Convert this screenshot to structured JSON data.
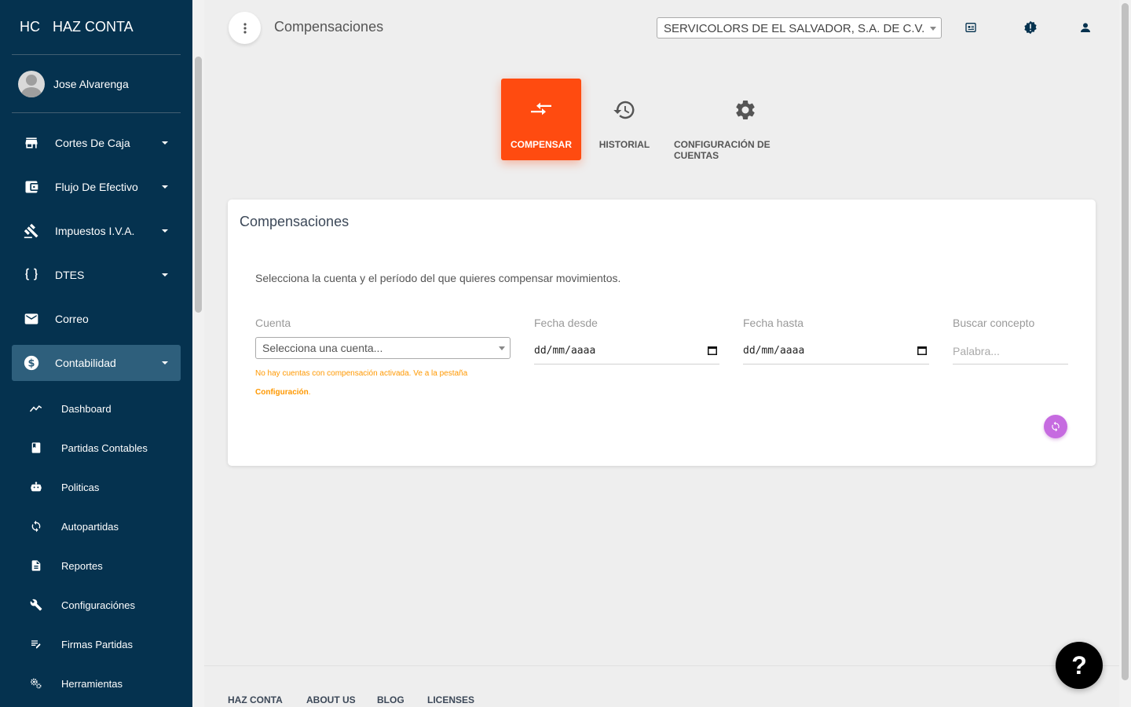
{
  "brand": {
    "mini": "HC",
    "name": "HAZ CONTA"
  },
  "user": {
    "name": "Jose Alvarenga"
  },
  "sidebar": {
    "items": [
      {
        "label": "Cortes De Caja",
        "icon": "store-icon",
        "expandable": true
      },
      {
        "label": "Flujo De Efectivo",
        "icon": "wallet-icon",
        "expandable": true
      },
      {
        "label": "Impuestos I.V.A.",
        "icon": "gavel-icon",
        "expandable": true
      },
      {
        "label": "DTES",
        "icon": "code-braces-icon",
        "expandable": true
      },
      {
        "label": "Correo",
        "icon": "mail-icon",
        "expandable": false
      },
      {
        "label": "Contabilidad",
        "icon": "dollar-icon",
        "expandable": true,
        "active": true
      }
    ],
    "subitems": [
      {
        "label": "Dashboard",
        "icon": "trending-icon"
      },
      {
        "label": "Partidas Contables",
        "icon": "book-icon"
      },
      {
        "label": "Politicas",
        "icon": "robot-icon"
      },
      {
        "label": "Autopartidas",
        "icon": "sync-icon"
      },
      {
        "label": "Reportes",
        "icon": "document-icon"
      },
      {
        "label": "Configuraciónes",
        "icon": "wrench-icon"
      },
      {
        "label": "Firmas Partidas",
        "icon": "edit-list-icon"
      },
      {
        "label": "Herramientas",
        "icon": "gears-icon"
      }
    ]
  },
  "header": {
    "title": "Compensaciones",
    "company": "SERVICOLORS DE EL SALVADOR, S.A. DE C.V."
  },
  "tabs": [
    {
      "label": "COMPENSAR",
      "icon": "compare-arrows-icon",
      "active": true
    },
    {
      "label": "HISTORIAL",
      "icon": "history-icon"
    },
    {
      "label": "CONFIGURACIÓN DE CUENTAS",
      "icon": "gear-icon"
    }
  ],
  "card": {
    "title": "Compensaciones",
    "description": "Selecciona la cuenta y el período del que quieres compensar movimientos.",
    "account_label": "Cuenta",
    "account_placeholder": "Selecciona una cuenta...",
    "warning_text": "No hay cuentas con compensación activada. Ve a la pestaña ",
    "warning_link": "Configuración",
    "warning_end": ".",
    "date_from_label": "Fecha desde",
    "date_from_value": "dd/mm/aaaa",
    "date_to_label": "Fecha hasta",
    "date_to_value": "dd/mm/aaaa",
    "search_label": "Buscar concepto",
    "search_placeholder": "Palabra..."
  },
  "footer": {
    "links": [
      "HAZ CONTA",
      "ABOUT US",
      "BLOG",
      "LICENSES"
    ]
  },
  "help": {
    "label": "?"
  },
  "colors": {
    "sidebar": "#05324f",
    "accent": "#ff4b10",
    "refresh": "#c66be0",
    "warning": "#ff9800"
  }
}
